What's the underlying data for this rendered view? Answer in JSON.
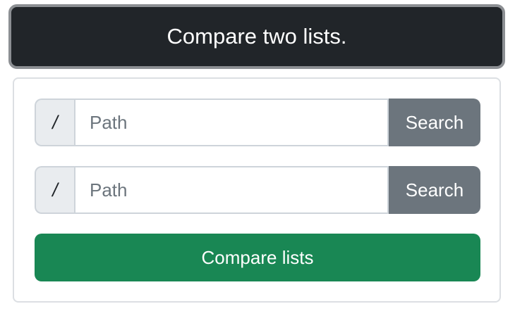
{
  "header": {
    "title": "Compare two lists."
  },
  "form": {
    "rows": [
      {
        "prefix": "/",
        "placeholder": "Path",
        "value": "",
        "button_label": "Search"
      },
      {
        "prefix": "/",
        "placeholder": "Path",
        "value": "",
        "button_label": "Search"
      }
    ],
    "submit_label": "Compare lists"
  },
  "colors": {
    "header_bg": "#212529",
    "secondary_button": "#6c757d",
    "success_button": "#198754",
    "prefix_bg": "#e9ecef"
  }
}
